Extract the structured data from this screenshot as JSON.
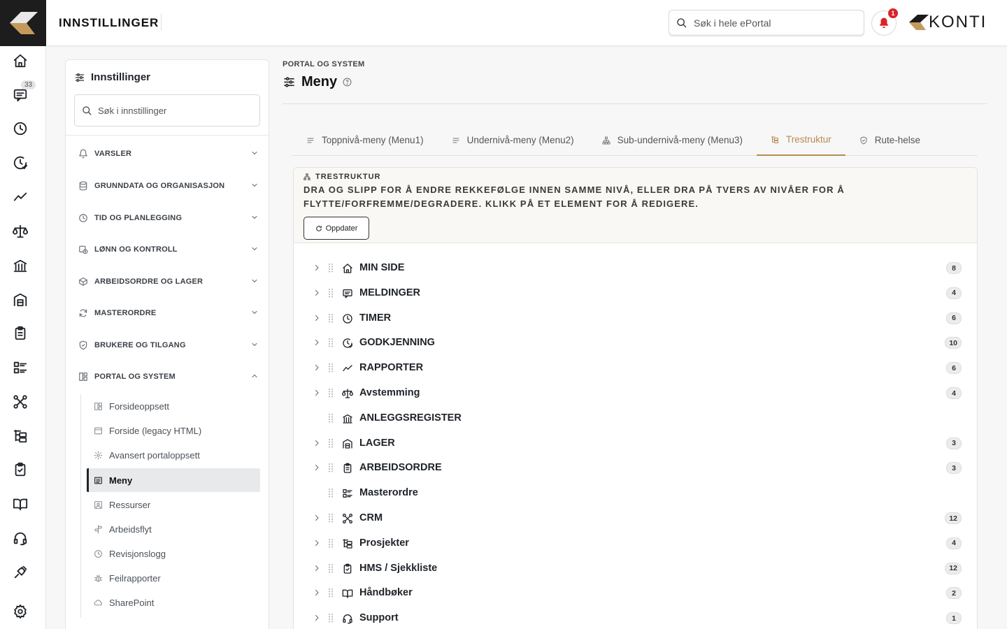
{
  "colors": {
    "accent": "#b58b4f",
    "dark": "#1d1d1d",
    "alert": "#d8232a"
  },
  "header": {
    "title": "INNSTILLINGER",
    "search_placeholder": "Søk i hele ePortal",
    "notification_count": "1",
    "brand": "KONTI"
  },
  "rail": {
    "messages_badge": "33",
    "icons": [
      "home-icon",
      "messages-icon",
      "clock-icon",
      "approval-clock-icon",
      "chart-icon",
      "balance-icon",
      "building-icon",
      "warehouse-icon",
      "clipboard-icon",
      "list-icon",
      "crm-icon",
      "tree-icon",
      "checklist-icon",
      "book-icon",
      "headset-icon",
      "plug-icon",
      "gear-icon"
    ]
  },
  "sidebar": {
    "title": "Innstillinger",
    "search_placeholder": "Søk i innstillinger",
    "sections": [
      {
        "label": "VARSLER",
        "icon": "bell-icon",
        "expanded": false
      },
      {
        "label": "GRUNNDATA OG ORGANISASJON",
        "icon": "database-icon",
        "expanded": false
      },
      {
        "label": "TID OG PLANLEGGING",
        "icon": "clock-icon",
        "expanded": false
      },
      {
        "label": "LØNN OG KONTROLL",
        "icon": "payroll-icon",
        "expanded": false
      },
      {
        "label": "ARBEIDSORDRE OG LAGER",
        "icon": "box-icon",
        "expanded": false
      },
      {
        "label": "MASTERORDRE",
        "icon": "refresh-icon",
        "expanded": false
      },
      {
        "label": "BRUKERE OG TILGANG",
        "icon": "shield-icon",
        "expanded": false
      },
      {
        "label": "PORTAL OG SYSTEM",
        "icon": "layout-icon",
        "expanded": true
      }
    ],
    "subitems": [
      {
        "label": "Forsideoppsett",
        "icon": "layout-icon"
      },
      {
        "label": "Forside (legacy HTML)",
        "icon": "window-icon"
      },
      {
        "label": "Avansert portaloppsett",
        "icon": "cog-icon"
      },
      {
        "label": "Meny",
        "icon": "menu-icon",
        "active": true
      },
      {
        "label": "Ressurser",
        "icon": "image-icon"
      },
      {
        "label": "Arbeidsflyt",
        "icon": "signpost-icon"
      },
      {
        "label": "Revisjonslogg",
        "icon": "clock-icon"
      },
      {
        "label": "Feilrapporter",
        "icon": "bug-icon"
      },
      {
        "label": "SharePoint",
        "icon": "cloud-icon"
      }
    ]
  },
  "main": {
    "breadcrumb": "PORTAL OG SYSTEM",
    "title": "Meny",
    "tabs": [
      {
        "label": "Toppnivå-meny (Menu1)",
        "icon": "lines-icon"
      },
      {
        "label": "Undernivå-meny (Menu2)",
        "icon": "lines-icon"
      },
      {
        "label": "Sub-undernivå-meny (Menu3)",
        "icon": "hierarchy-icon"
      },
      {
        "label": "Trestruktur",
        "icon": "tree-icon",
        "active": true
      },
      {
        "label": "Rute-helse",
        "icon": "shield-icon"
      }
    ],
    "tree": {
      "label": "TRESTRUKTUR",
      "description": "DRA OG SLIPP FOR Å ENDRE REKKEFØLGE INNEN SAMME NIVÅ, ELLER DRA PÅ TVERS AV NIVÅER FOR Å FLYTTE/FORFREMME/DEGRADERE. KLIKK PÅ ET ELEMENT FOR Å REDIGERE.",
      "refresh_label": "Oppdater",
      "items": [
        {
          "label": "MIN SIDE",
          "icon": "home-icon",
          "count": "8",
          "expandable": true
        },
        {
          "label": "MELDINGER",
          "icon": "messages-icon",
          "count": "4",
          "expandable": true
        },
        {
          "label": "TIMER",
          "icon": "clock-icon",
          "count": "6",
          "expandable": true
        },
        {
          "label": "GODKJENNING",
          "icon": "approval-clock-icon",
          "count": "10",
          "expandable": true
        },
        {
          "label": "RAPPORTER",
          "icon": "chart-icon",
          "count": "6",
          "expandable": true
        },
        {
          "label": "Avstemming",
          "icon": "balance-icon",
          "count": "4",
          "expandable": true
        },
        {
          "label": "ANLEGGSREGISTER",
          "icon": "building-icon",
          "count": "",
          "expandable": false
        },
        {
          "label": "LAGER",
          "icon": "warehouse-icon",
          "count": "3",
          "expandable": true
        },
        {
          "label": "ARBEIDSORDRE",
          "icon": "clipboard-icon",
          "count": "3",
          "expandable": true
        },
        {
          "label": "Masterordre",
          "icon": "list-icon",
          "count": "",
          "expandable": false
        },
        {
          "label": "CRM",
          "icon": "crm-icon",
          "count": "12",
          "expandable": true
        },
        {
          "label": "Prosjekter",
          "icon": "tree-icon",
          "count": "4",
          "expandable": true
        },
        {
          "label": "HMS / Sjekkliste",
          "icon": "checklist-icon",
          "count": "12",
          "expandable": true
        },
        {
          "label": "Håndbøker",
          "icon": "book-icon",
          "count": "2",
          "expandable": true
        },
        {
          "label": "Support",
          "icon": "headset-icon",
          "count": "1",
          "expandable": true
        }
      ]
    }
  }
}
